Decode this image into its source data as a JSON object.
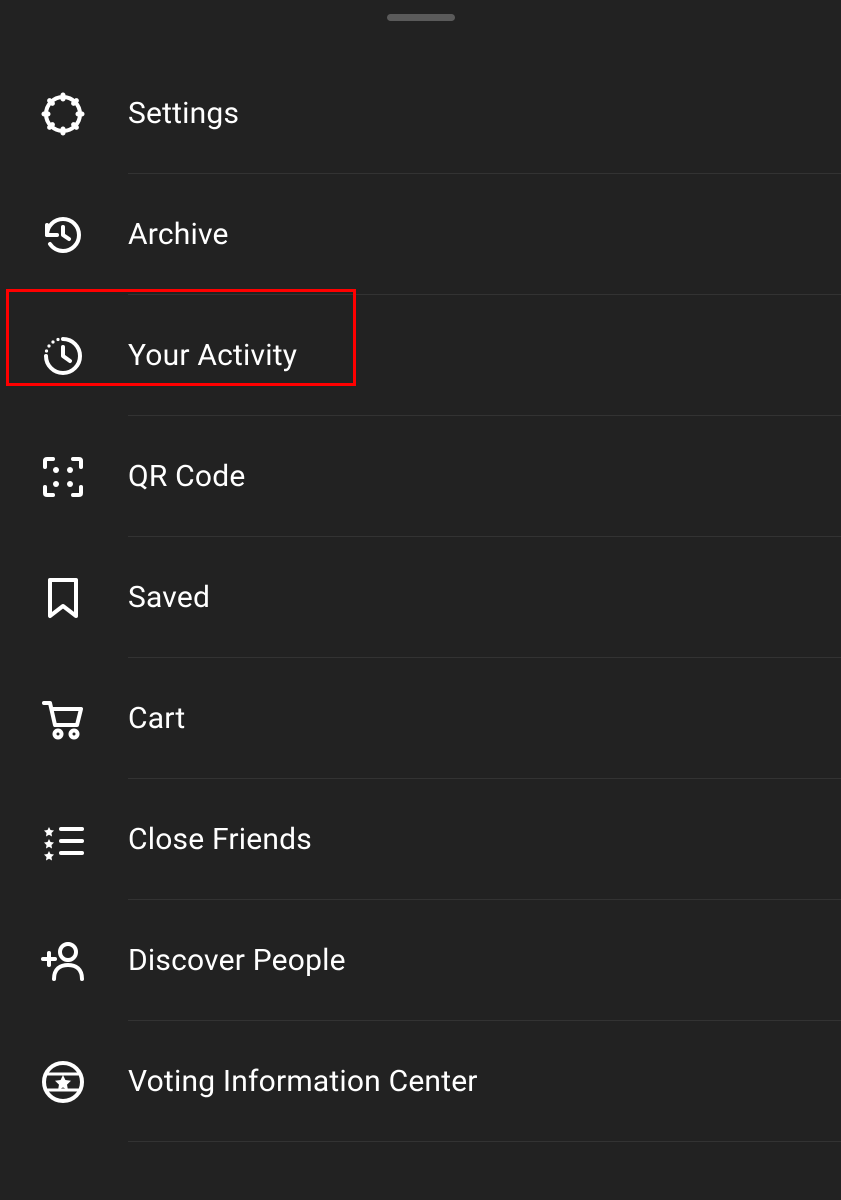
{
  "menu": {
    "items": [
      {
        "label": "Settings"
      },
      {
        "label": "Archive"
      },
      {
        "label": "Your Activity"
      },
      {
        "label": "QR Code"
      },
      {
        "label": "Saved"
      },
      {
        "label": "Cart"
      },
      {
        "label": "Close Friends"
      },
      {
        "label": "Discover People"
      },
      {
        "label": "Voting Information Center"
      }
    ]
  },
  "highlighted_index": 2
}
